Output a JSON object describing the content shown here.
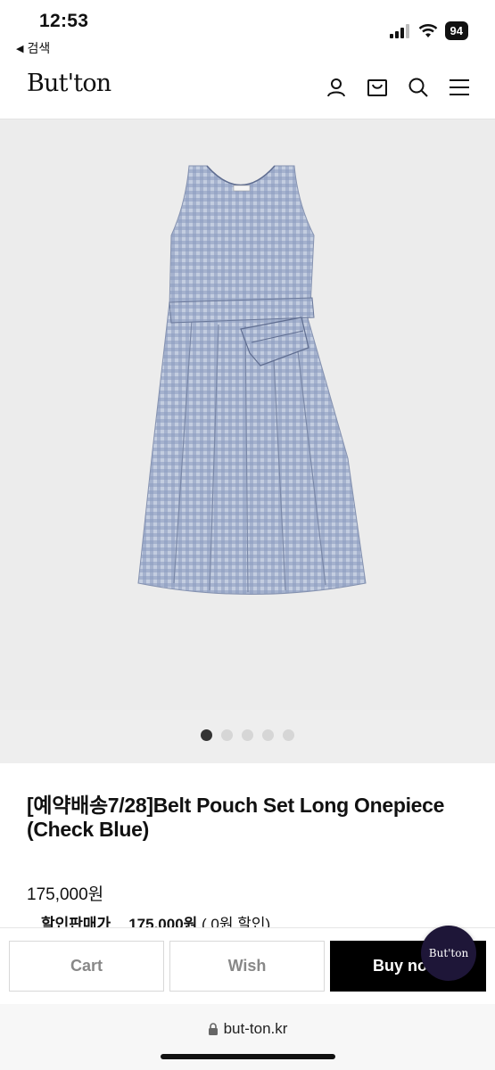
{
  "status_bar": {
    "time": "12:53",
    "back_app": "검색",
    "battery": "94"
  },
  "header": {
    "logo": "But'ton",
    "icons": [
      "user-icon",
      "cart-icon",
      "search-icon",
      "menu-icon"
    ]
  },
  "carousel": {
    "dot_count": 5,
    "active_index": 0
  },
  "product": {
    "title": "[예약배송7/28]Belt Pouch Set Long Onepiece (Check Blue)",
    "price": "175,000원",
    "sale_label": "할인판매가",
    "sale_price": "175,000원",
    "sale_note": "( 0원 할인)"
  },
  "actions": {
    "cart": "Cart",
    "wish": "Wish",
    "buy": "Buy now",
    "chat_logo": "But'ton"
  },
  "browser": {
    "url": "but-ton.kr"
  },
  "colors": {
    "accent": "#000000",
    "image_background": "#ececec",
    "dress": "#9aa9c6",
    "chat_bubble": "#1e1638"
  }
}
